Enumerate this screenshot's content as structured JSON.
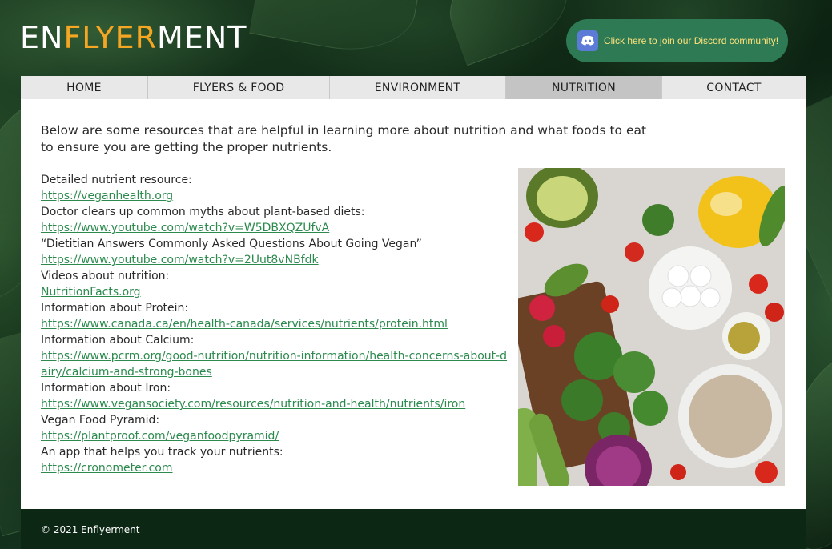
{
  "logo": {
    "part1": "EN",
    "part2": "FLYER",
    "part3": "MENT"
  },
  "discord": {
    "label": "Click here to join our Discord community!",
    "icon": "discord-icon"
  },
  "nav": {
    "items": [
      {
        "label": "HOME"
      },
      {
        "label": "FLYERS & FOOD"
      },
      {
        "label": "ENVIRONMENT"
      },
      {
        "label": "NUTRITION",
        "active": true
      },
      {
        "label": "CONTACT"
      }
    ]
  },
  "intro": "Below are some resources that are helpful in learning more about nutrition and what foods to eat to ensure you are getting the proper nutrients.",
  "resources": [
    {
      "label": "Detailed nutrient resource:",
      "link": "https://veganhealth.org"
    },
    {
      "label": "Doctor clears up common myths about plant-based diets:",
      "link": "https://www.youtube.com/watch?v=W5DBXQZUfvA"
    },
    {
      "label": "“Dietitian Answers Commonly Asked Questions About Going Vegan”",
      "link": "https://www.youtube.com/watch?v=2Uut8vNBfdk"
    },
    {
      "label": "Videos about nutrition:",
      "link": "NutritionFacts.org"
    },
    {
      "label": "Information about Protein:",
      "link": "https://www.canada.ca/en/health-canada/services/nutrients/protein.html"
    },
    {
      "label": "Information about Calcium:",
      "link": "https://www.pcrm.org/good-nutrition/nutrition-information/health-concerns-about-dairy/calcium-and-strong-bones"
    },
    {
      "label": "Information about Iron:",
      "link": "https://www.vegansociety.com/resources/nutrition-and-health/nutrients/iron"
    },
    {
      "label": "Vegan Food Pyramid:",
      "link": "https://plantproof.com/veganfoodpyramid/"
    },
    {
      "label": "An app that helps you track your nutrients:",
      "link": "https://cronometer.com"
    }
  ],
  "footer": {
    "copyright": "© 2021 Enflyerment"
  },
  "colors": {
    "accent": "#f5a623",
    "link": "#2d8a4e",
    "discord_bg": "#2e7a55",
    "footer_bg": "#0c2714"
  }
}
